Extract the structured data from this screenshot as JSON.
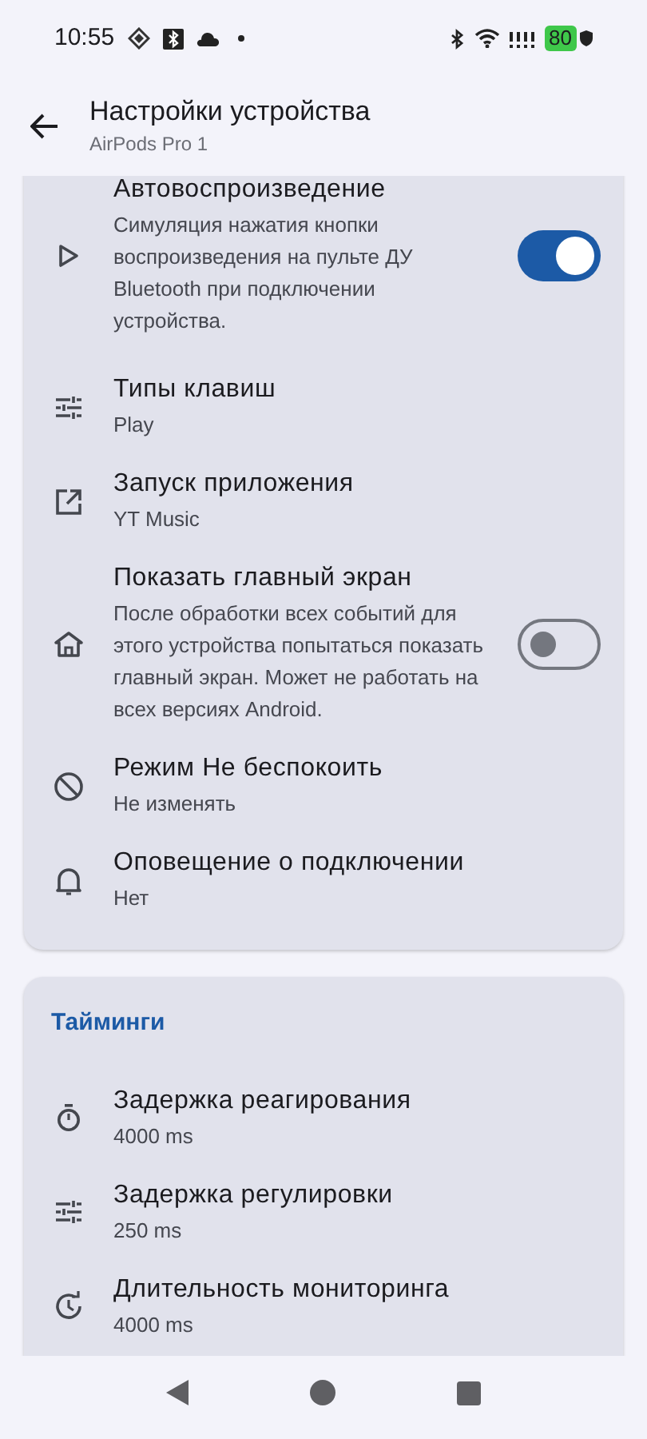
{
  "status_bar": {
    "time": "10:55",
    "battery": "80"
  },
  "app_bar": {
    "title": "Настройки устройства",
    "subtitle": "AirPods Pro 1"
  },
  "sections": [
    {
      "items": [
        {
          "kind": "switch",
          "title": "Автовоспроизведение",
          "summary": "Симуляция нажатия кнопки воспроизведения на пульте ДУ Bluetooth при подключении устройства.",
          "on": true
        },
        {
          "kind": "value",
          "title": "Типы клавиш",
          "summary": "Play"
        },
        {
          "kind": "value",
          "title": "Запуск приложения",
          "summary": "YT Music"
        },
        {
          "kind": "switch",
          "title": "Показать главный экран",
          "summary": "После обработки всех событий для этого устройства попытаться показать главный экран. Может не работать на всех версиях Android.",
          "on": false
        },
        {
          "kind": "value",
          "title": "Режим Не беспокоить",
          "summary": "Не изменять"
        },
        {
          "kind": "value",
          "title": "Оповещение о подключении",
          "summary": "Нет"
        }
      ]
    },
    {
      "header": "Тайминги",
      "items": [
        {
          "kind": "value",
          "title": "Задержка реагирования",
          "summary": "4000 ms"
        },
        {
          "kind": "value",
          "title": "Задержка регулировки",
          "summary": "250 ms"
        },
        {
          "kind": "value",
          "title": "Длительность мониторинга",
          "summary": "4000 ms"
        }
      ]
    }
  ]
}
